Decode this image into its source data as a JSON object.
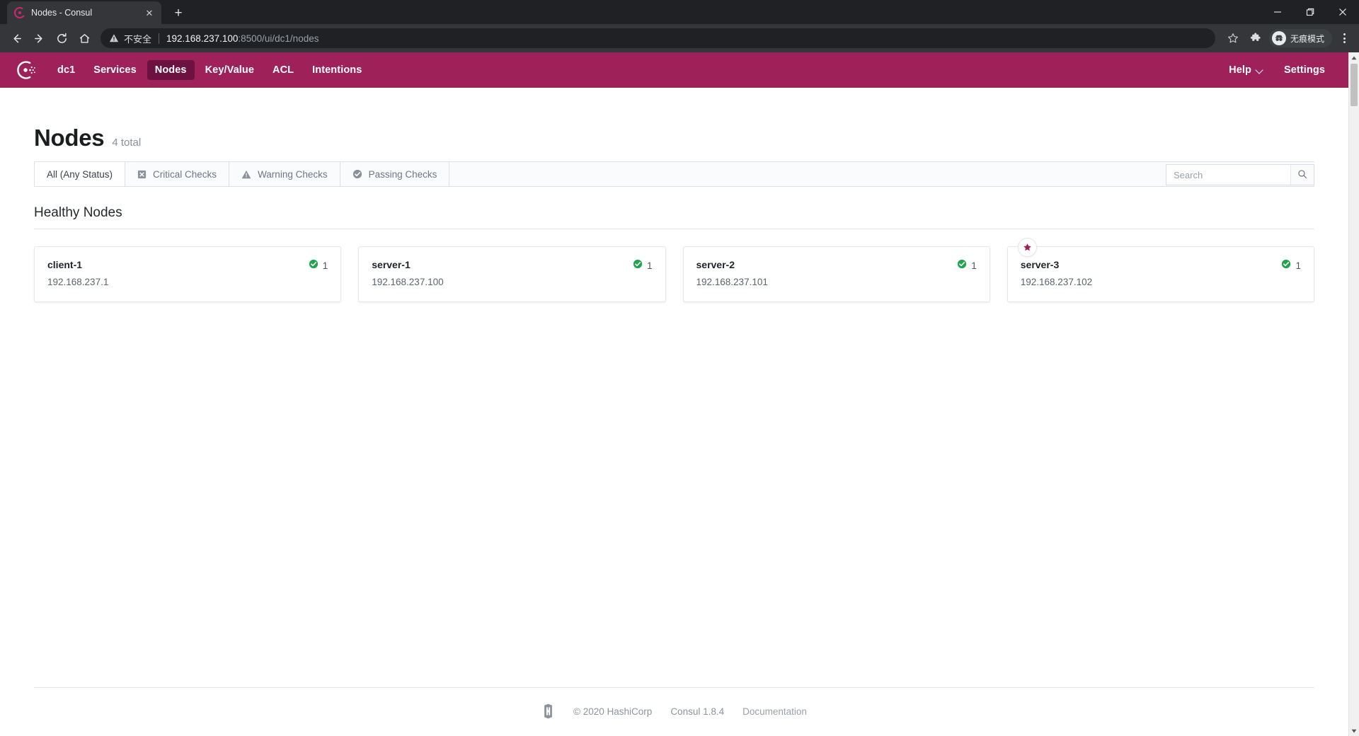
{
  "browser": {
    "tab": {
      "title": "Nodes - Consul",
      "favicon": "consul-favicon",
      "close": "✕"
    },
    "newtab_label": "+",
    "window_controls": {
      "minimize": "minimize-icon",
      "maximize": "maximize-icon",
      "close": "close-icon"
    },
    "toolbar": {
      "back": "back-icon",
      "forward": "forward-icon",
      "reload": "reload-icon",
      "home": "home-icon",
      "security_label": "不安全",
      "url_host": "192.168.237.100",
      "url_path": ":8500/ui/dc1/nodes",
      "bookmark": "star-icon",
      "extensions": "puzzle-icon",
      "incognito_label": "无痕模式",
      "menu": "more-vertical-icon"
    }
  },
  "nav": {
    "logo": "consul-logo",
    "datacenter": "dc1",
    "items": [
      {
        "label": "Services",
        "active": false
      },
      {
        "label": "Nodes",
        "active": true
      },
      {
        "label": "Key/Value",
        "active": false
      },
      {
        "label": "ACL",
        "active": false
      },
      {
        "label": "Intentions",
        "active": false
      }
    ],
    "help": "Help",
    "settings": "Settings",
    "brand_color": "#9E2159",
    "active_color": "#6d1240"
  },
  "page": {
    "title": "Nodes",
    "total": "4 total",
    "filters": [
      {
        "label": "All (Any Status)",
        "icon": null,
        "active": true
      },
      {
        "label": "Critical Checks",
        "icon": "critical-x-icon",
        "active": false
      },
      {
        "label": "Warning Checks",
        "icon": "warning-triangle-icon",
        "active": false
      },
      {
        "label": "Passing Checks",
        "icon": "passing-check-icon",
        "active": false
      }
    ],
    "search": {
      "value": "",
      "placeholder": "Search",
      "button_icon": "search-icon"
    },
    "section_title": "Healthy Nodes",
    "nodes": [
      {
        "name": "client-1",
        "ip": "192.168.237.1",
        "health_count": "1",
        "status": "passing",
        "leader": false
      },
      {
        "name": "server-1",
        "ip": "192.168.237.100",
        "health_count": "1",
        "status": "passing",
        "leader": false
      },
      {
        "name": "server-2",
        "ip": "192.168.237.101",
        "health_count": "1",
        "status": "passing",
        "leader": false
      },
      {
        "name": "server-3",
        "ip": "192.168.237.102",
        "health_count": "1",
        "status": "passing",
        "leader": true
      }
    ],
    "status_color_passing": "#20a44c",
    "leader_star_color": "#9E2159"
  },
  "footer": {
    "logo": "hashicorp-logo",
    "copyright": "© 2020 HashiCorp",
    "version": "Consul 1.8.4",
    "docs": "Documentation"
  }
}
